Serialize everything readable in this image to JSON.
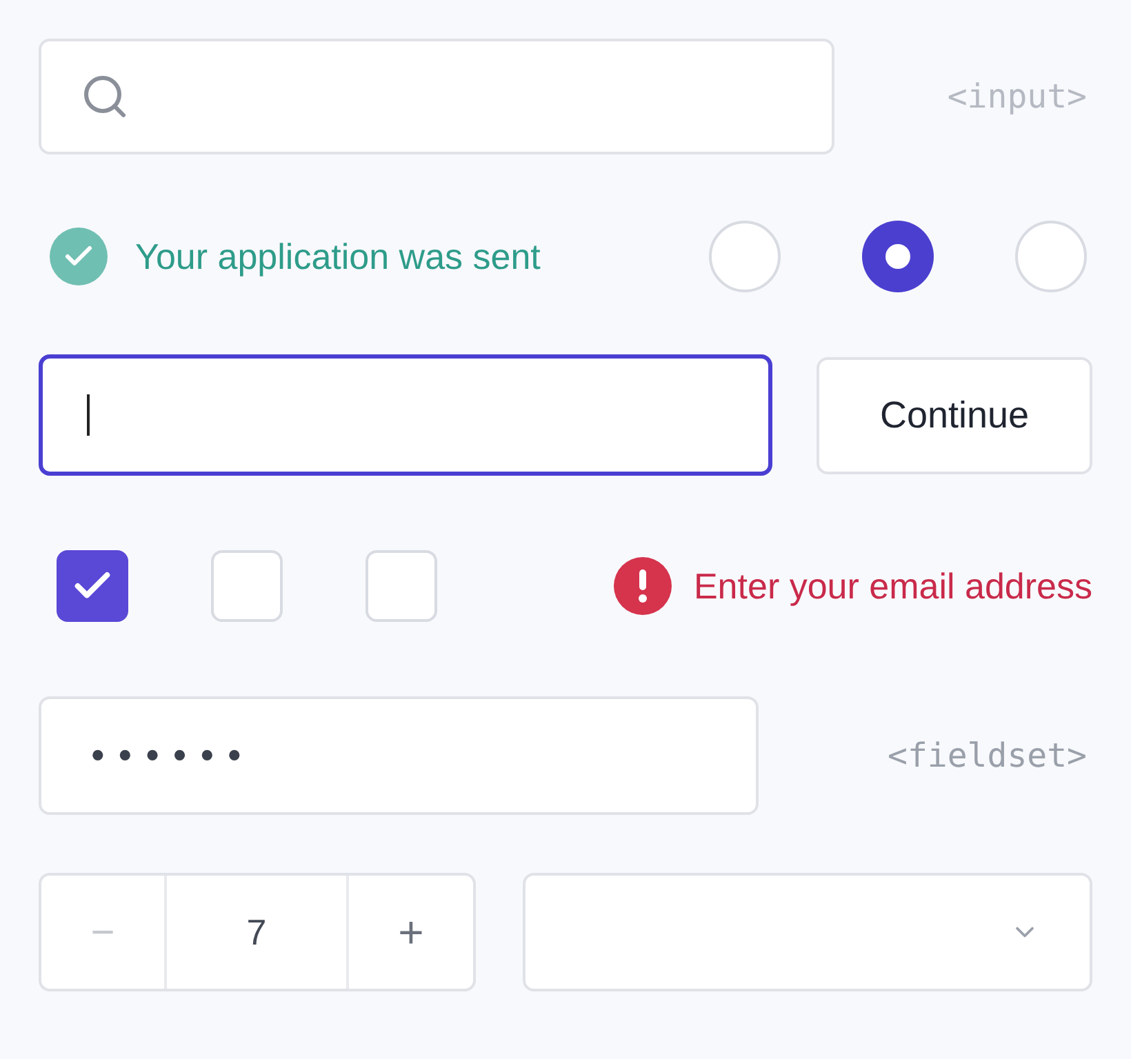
{
  "search": {
    "tag": "<input>"
  },
  "status": {
    "kind": "success",
    "message": "Your application was sent"
  },
  "radios": [
    {
      "selected": false
    },
    {
      "selected": true
    },
    {
      "selected": false
    }
  ],
  "text_field": {
    "focused": true
  },
  "continue_button": "Continue",
  "checkboxes": [
    {
      "checked": true
    },
    {
      "checked": false
    },
    {
      "checked": false
    }
  ],
  "error": {
    "message": "Enter your email address"
  },
  "password": {
    "value": "••••••",
    "tag": "<fieldset>"
  },
  "stepper": {
    "decrement": "−",
    "value": "7",
    "increment": "+"
  }
}
